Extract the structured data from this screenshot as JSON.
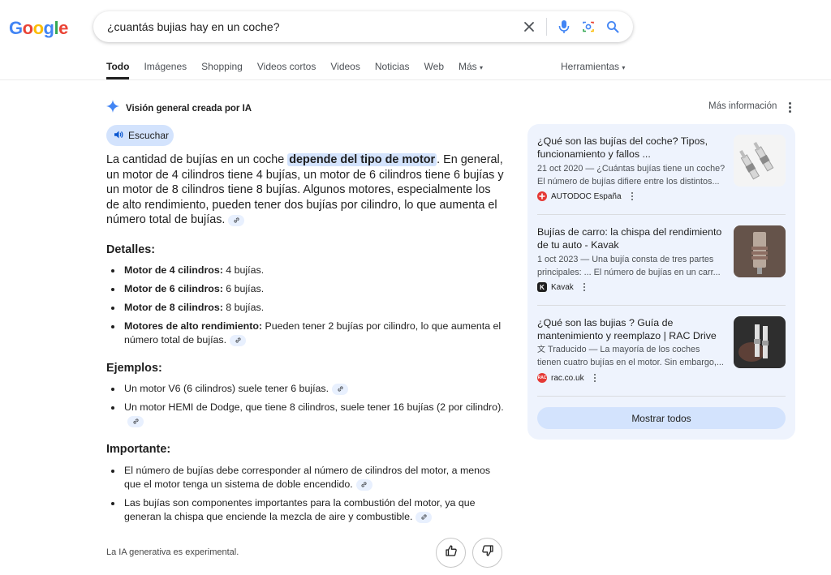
{
  "header": {
    "logo_letters": [
      "G",
      "o",
      "o",
      "g",
      "l",
      "e"
    ],
    "logo_colors": [
      "#4285f4",
      "#ea4335",
      "#fbbc05",
      "#4285f4",
      "#34a853",
      "#ea4335"
    ],
    "search_query": "¿cuantás bujias hay en un coche?"
  },
  "tabs": [
    "Todo",
    "Imágenes",
    "Shopping",
    "Videos cortos",
    "Videos",
    "Noticias",
    "Web",
    "Más"
  ],
  "tools_label": "Herramientas",
  "ai_overview": {
    "title": "Visión general creada por IA",
    "more_info": "Más información",
    "listen_label": "Escuchar",
    "intro_before": "La cantidad de bujías en un coche ",
    "intro_highlight": "depende del tipo de motor",
    "intro_after": ". En general, un motor de 4 cilindros tiene 4 bujías, un motor de 6 cilindros tiene 6 bujías y un motor de 8 cilindros tiene 8 bujías. Algunos motores, especialmente los de alto rendimiento, pueden tener dos bujías por cilindro, lo que aumenta el número total de bujías.",
    "details_title": "Detalles:",
    "details": [
      {
        "bold": "Motor de 4 cilindros:",
        "text": " 4 bujías."
      },
      {
        "bold": "Motor de 6 cilindros:",
        "text": " 6 bujías."
      },
      {
        "bold": "Motor de 8 cilindros:",
        "text": " 8 bujías."
      },
      {
        "bold": "Motores de alto rendimiento:",
        "text": " Pueden tener 2 bujías por cilindro, lo que aumenta el número total de bujías."
      }
    ],
    "examples_title": "Ejemplos:",
    "examples": [
      "Un motor V6 (6 cilindros) suele tener 6 bujías.",
      "Un motor HEMI de Dodge, que tiene 8 cilindros, suele tener 16 bujías (2 por cilindro)."
    ],
    "important_title": "Importante:",
    "important": [
      "El número de bujías debe corresponder al número de cilindros del motor, a menos que el motor tenga un sistema de doble encendido.",
      "Las bujías son componentes importantes para la combustión del motor, ya que generan la chispa que enciende la mezcla de aire y combustible."
    ],
    "experimental_note": "La IA generativa es experimental."
  },
  "sources": [
    {
      "title": "¿Qué son las bujías del coche? Tipos, funcionamiento y fallos ...",
      "snippet": "21 oct 2020 — ¿Cuántas bujías tiene un coche? El número de bujías difiere entre los distintos...",
      "site": "AUTODOC España",
      "favicon_color": "#e53935"
    },
    {
      "title": "Bujías de carro: la chispa del rendimiento de tu auto - Kavak",
      "snippet": "1 oct 2023 — Una bujía consta de tres partes principales: ... El número de bujías en un carr...",
      "site": "Kavak",
      "favicon_color": "#1f1f1f"
    },
    {
      "title": "¿Qué son las bujias ? Guía de mantenimiento y reemplazo | RAC Drive",
      "snippet_prefix": "Traducido",
      "snippet": " — La mayoría de los coches tienen cuatro bujías en el motor. Sin embargo,...",
      "site": "rac.co.uk",
      "favicon_color": "#e53935"
    }
  ],
  "show_all_label": "Mostrar todos"
}
